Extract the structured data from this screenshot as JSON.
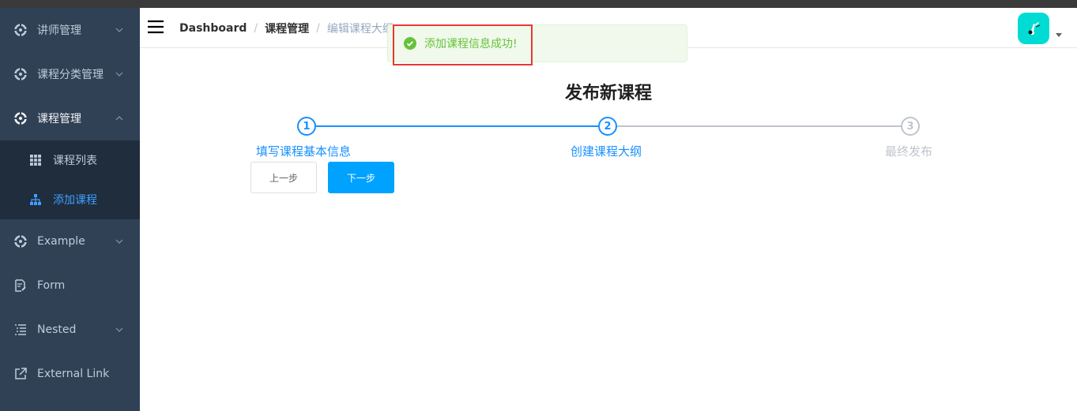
{
  "sidebar": {
    "items": [
      {
        "label": "讲师管理",
        "icon": "gear-circle-icon",
        "has_children": true,
        "expanded": false
      },
      {
        "label": "课程分类管理",
        "icon": "gear-circle-icon",
        "has_children": true,
        "expanded": false
      },
      {
        "label": "课程管理",
        "icon": "gear-circle-icon",
        "has_children": true,
        "expanded": true
      },
      {
        "label": "Example",
        "icon": "gear-circle-icon",
        "has_children": true,
        "expanded": false
      },
      {
        "label": "Form",
        "icon": "form-icon",
        "has_children": false
      },
      {
        "label": "Nested",
        "icon": "nested-list-icon",
        "has_children": true,
        "expanded": false
      },
      {
        "label": "External Link",
        "icon": "external-link-icon",
        "has_children": false
      }
    ],
    "course_sub": [
      {
        "label": "课程列表",
        "icon": "table-icon",
        "active": false
      },
      {
        "label": "添加课程",
        "icon": "tree-icon",
        "active": true
      }
    ]
  },
  "navbar": {
    "breadcrumb": [
      "Dashboard",
      "课程管理",
      "编辑课程大纲"
    ],
    "separator": "/"
  },
  "toast": {
    "message": "添加课程信息成功!",
    "type": "success"
  },
  "main": {
    "title": "发布新课程",
    "steps": [
      {
        "num": "1",
        "label": "填写课程基本信息",
        "status": "done"
      },
      {
        "num": "2",
        "label": "创建课程大纲",
        "status": "done"
      },
      {
        "num": "3",
        "label": "最终发布",
        "status": "wait"
      }
    ],
    "prev_label": "上一步",
    "next_label": "下一步"
  },
  "colors": {
    "sidebar_bg": "#304156",
    "submenu_bg": "#1f2d3d",
    "active_text": "#409eff",
    "step_active": "#1890ff",
    "primary_button": "#00a2ff",
    "success_text": "#67c23a",
    "avatar_bg": "#00dcd4",
    "highlight_border": "#e53935"
  }
}
